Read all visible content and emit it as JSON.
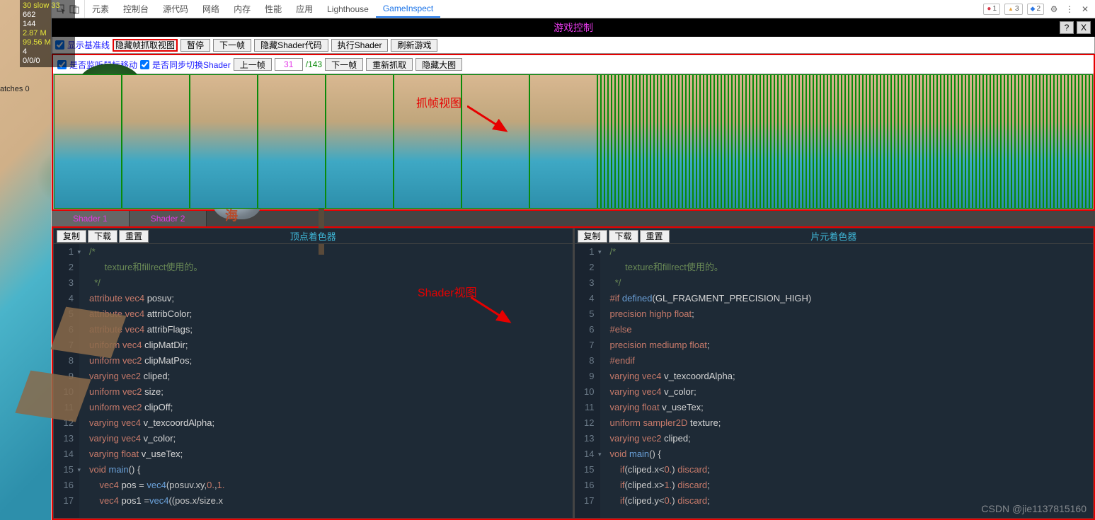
{
  "stats": {
    "l1": "30 slow 33",
    "l2": "662",
    "l3": "144",
    "l4": "2.87 M",
    "l5": "99.56 M",
    "l6": "4",
    "l7": "0/0/0",
    "side": "atches 0"
  },
  "stone_text": "东海",
  "devtools": {
    "tabs": [
      "元素",
      "控制台",
      "源代码",
      "网络",
      "内存",
      "性能",
      "应用",
      "Lighthouse",
      "GameInspect"
    ],
    "active": "GameInspect",
    "badges": {
      "err": "1",
      "warn": "3",
      "info": "2"
    }
  },
  "blackbar": {
    "title": "游戏控制",
    "help": "?",
    "close": "X"
  },
  "ctrlRow": {
    "cb1": "显示基准线",
    "btn1": "隐藏帧抓取视图",
    "btn2": "暂停",
    "btn3": "下一帧",
    "btn4": "隐藏Shader代码",
    "btn5": "执行Shader",
    "btn6": "刷新游戏"
  },
  "frameCtrl": {
    "cb1": "是否监听鼠标移动",
    "cb2": "是否同步切换Shader",
    "prev": "上一帧",
    "cur": "31",
    "total": "/143",
    "next": "下一帧",
    "recap": "重新抓取",
    "hidebig": "隐藏大图"
  },
  "shaderTabs": [
    "Shader 1",
    "Shader 2"
  ],
  "editor": {
    "copy": "复制",
    "dl": "下载",
    "reset": "重置",
    "vtitle": "顶点着色器",
    "ftitle": "片元着色器"
  },
  "vshader": [
    {
      "n": "1",
      "f": true,
      "h": "<span class='c-com'>/*</span>"
    },
    {
      "n": "2",
      "h": "<span class='c-com'>      texture和fillrect使用的。</span>"
    },
    {
      "n": "3",
      "h": "<span class='c-com'>  */</span>"
    },
    {
      "n": "4",
      "h": "<span class='c-kw'>attribute</span> <span class='c-type'>vec4</span> <span class='c-id'>posuv</span>;"
    },
    {
      "n": "5",
      "h": "<span class='c-kw'>attribute</span> <span class='c-type'>vec4</span> <span class='c-id'>attribColor</span>;"
    },
    {
      "n": "6",
      "h": "<span class='c-kw'>attribute</span> <span class='c-type'>vec4</span> <span class='c-id'>attribFlags</span>;"
    },
    {
      "n": "7",
      "h": "<span class='c-kw'>uniform</span> <span class='c-type'>vec4</span> <span class='c-id'>clipMatDir</span>;"
    },
    {
      "n": "8",
      "h": "<span class='c-kw'>uniform</span> <span class='c-type'>vec2</span> <span class='c-id'>clipMatPos</span>;"
    },
    {
      "n": "9",
      "h": "<span class='c-kw'>varying</span> <span class='c-type'>vec2</span> <span class='c-id'>cliped</span>;"
    },
    {
      "n": "10",
      "h": "<span class='c-kw'>uniform</span> <span class='c-type'>vec2</span> <span class='c-id'>size</span>;"
    },
    {
      "n": "11",
      "h": "<span class='c-kw'>uniform</span> <span class='c-type'>vec2</span> <span class='c-id'>clipOff</span>;"
    },
    {
      "n": "12",
      "h": "<span class='c-kw'>varying</span> <span class='c-type'>vec4</span> <span class='c-id'>v_texcoordAlpha</span>;"
    },
    {
      "n": "13",
      "h": "<span class='c-kw'>varying</span> <span class='c-type'>vec4</span> <span class='c-id'>v_color</span>;"
    },
    {
      "n": "14",
      "h": "<span class='c-kw'>varying</span> <span class='c-type'>float</span> <span class='c-id'>v_useTex</span>;"
    },
    {
      "n": "15",
      "f": true,
      "h": "<span class='c-kw'>void</span> <span class='c-fn'>main</span>() {"
    },
    {
      "n": "16",
      "h": "    <span class='c-type'>vec4</span> <span class='c-id'>pos</span> = <span class='c-fn'>vec4</span>(posuv.xy,<span class='c-num'>0.</span>,<span class='c-num'>1.</span>"
    },
    {
      "n": "17",
      "h": "    <span class='c-type'>vec4</span> <span class='c-id'>pos1</span> =<span class='c-fn'>vec4</span>((pos.x/size.x"
    }
  ],
  "fshader": [
    {
      "n": "1",
      "f": true,
      "h": "<span class='c-com'>/*</span>"
    },
    {
      "n": "2",
      "h": "<span class='c-com'>      texture和fillrect使用的。</span>"
    },
    {
      "n": "3",
      "h": "<span class='c-com'>  */</span>"
    },
    {
      "n": "4",
      "h": "<span class='c-pp'>#if</span> <span class='c-mac'>defined</span>(<span class='c-id'>GL_FRAGMENT_PRECISION_HIGH</span>)"
    },
    {
      "n": "5",
      "h": "<span class='c-kw'>precision highp</span> <span class='c-type'>float</span>;"
    },
    {
      "n": "6",
      "h": "<span class='c-pp'>#else</span>"
    },
    {
      "n": "7",
      "h": "<span class='c-kw'>precision mediump</span> <span class='c-type'>float</span>;"
    },
    {
      "n": "8",
      "h": "<span class='c-pp'>#endif</span>"
    },
    {
      "n": "9",
      "h": "<span class='c-kw'>varying</span> <span class='c-type'>vec4</span> <span class='c-id'>v_texcoordAlpha</span>;"
    },
    {
      "n": "10",
      "h": "<span class='c-kw'>varying</span> <span class='c-type'>vec4</span> <span class='c-id'>v_color</span>;"
    },
    {
      "n": "11",
      "h": "<span class='c-kw'>varying</span> <span class='c-type'>float</span> <span class='c-id'>v_useTex</span>;"
    },
    {
      "n": "12",
      "h": "<span class='c-kw'>uniform</span> <span class='c-type'>sampler2D</span> <span class='c-id'>texture</span>;"
    },
    {
      "n": "13",
      "h": "<span class='c-kw'>varying</span> <span class='c-type'>vec2</span> <span class='c-id'>cliped</span>;"
    },
    {
      "n": "14",
      "f": true,
      "h": "<span class='c-kw'>void</span> <span class='c-fn'>main</span>() {"
    },
    {
      "n": "15",
      "h": "    <span class='c-kw'>if</span>(cliped.x&lt;<span class='c-num'>0.</span>) <span class='c-kw'>discard</span>;"
    },
    {
      "n": "16",
      "h": "    <span class='c-kw'>if</span>(cliped.x&gt;<span class='c-num'>1.</span>) <span class='c-kw'>discard</span>;"
    },
    {
      "n": "17",
      "h": "    <span class='c-kw'>if</span>(cliped.y&lt;<span class='c-num'>0.</span>) <span class='c-kw'>discard</span>;"
    }
  ],
  "annot": {
    "frameView": "抓帧视图",
    "shaderView": "Shader视图"
  },
  "watermark": "CSDN @jie1137815160"
}
